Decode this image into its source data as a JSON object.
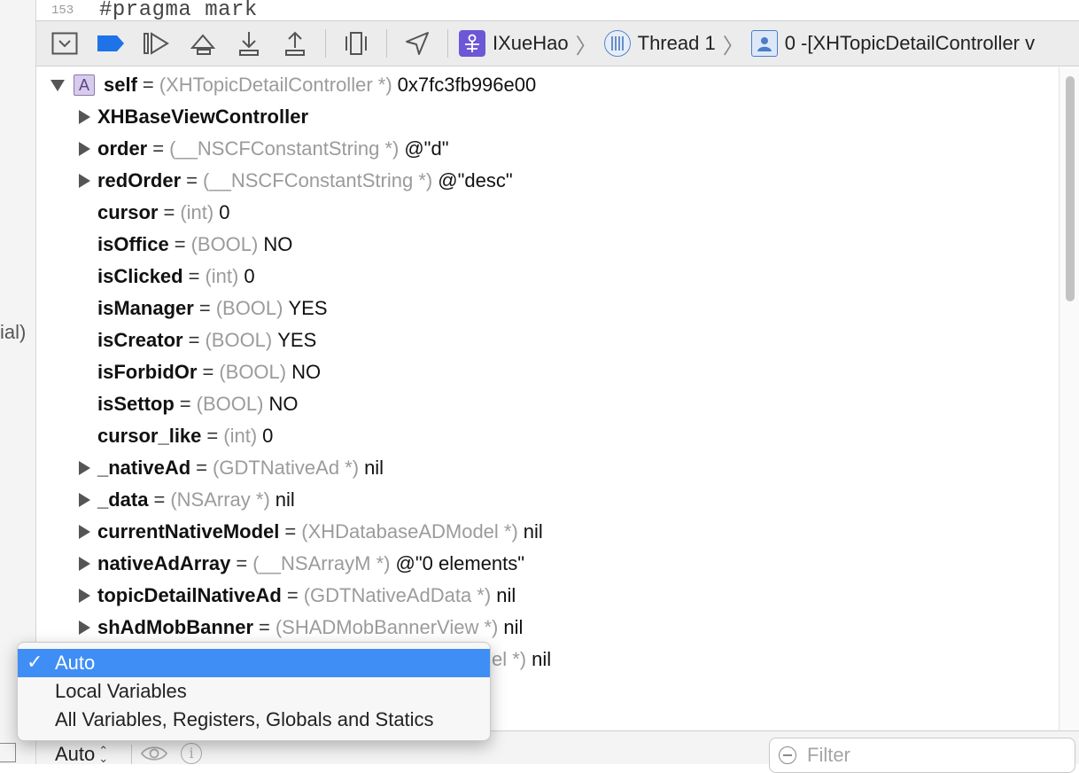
{
  "editor": {
    "line_number": "153",
    "code_line": "#pragma mark"
  },
  "gutter": {
    "partial_text": "ial)"
  },
  "toolbar": {
    "buttons": [
      "hide-debug-area",
      "breakpoints-toggle",
      "continue",
      "step-over",
      "step-into",
      "step-out",
      "view-hierarchy",
      "simulate-location"
    ],
    "breadcrumb": {
      "app": "IXueHao",
      "thread": "Thread 1",
      "frame": "0 -[XHTopicDetailController v"
    }
  },
  "variables": {
    "self": {
      "name": "self",
      "type": "(XHTopicDetailController *)",
      "value": "0x7fc3fb996e00"
    },
    "items": [
      {
        "name": "XHBaseViewController",
        "type": "",
        "value": "",
        "expandable": true
      },
      {
        "name": "order",
        "type": "(__NSCFConstantString *)",
        "value": "@\"d\"",
        "expandable": true
      },
      {
        "name": "redOrder",
        "type": "(__NSCFConstantString *)",
        "value": "@\"desc\"",
        "expandable": true
      },
      {
        "name": "cursor",
        "type": "(int)",
        "value": "0",
        "expandable": false
      },
      {
        "name": "isOffice",
        "type": "(BOOL)",
        "value": "NO",
        "expandable": false
      },
      {
        "name": "isClicked",
        "type": "(int)",
        "value": "0",
        "expandable": false
      },
      {
        "name": "isManager",
        "type": "(BOOL)",
        "value": "YES",
        "expandable": false
      },
      {
        "name": "isCreator",
        "type": "(BOOL)",
        "value": "YES",
        "expandable": false
      },
      {
        "name": "isForbidOr",
        "type": "(BOOL)",
        "value": "NO",
        "expandable": false
      },
      {
        "name": "isSettop",
        "type": "(BOOL)",
        "value": "NO",
        "expandable": false
      },
      {
        "name": "cursor_like",
        "type": "(int)",
        "value": "0",
        "expandable": false
      },
      {
        "name": "_nativeAd",
        "type": "(GDTNativeAd *)",
        "value": "nil",
        "expandable": true
      },
      {
        "name": "_data",
        "type": "(NSArray *)",
        "value": "nil",
        "expandable": true
      },
      {
        "name": "currentNativeModel",
        "type": "(XHDatabaseADModel *)",
        "value": "nil",
        "expandable": true
      },
      {
        "name": "nativeAdArray",
        "type": "(__NSArrayM *)",
        "value": "@\"0 elements\"",
        "expandable": true
      },
      {
        "name": "topicDetailNativeAd",
        "type": "(GDTNativeAdData *)",
        "value": "nil",
        "expandable": true
      },
      {
        "name": "shAdMobBanner",
        "type": "(SHADMobBannerView *)",
        "value": "nil",
        "expandable": true
      }
    ],
    "partial_row": {
      "type_tail": "el *)",
      "value": "nil"
    }
  },
  "scope_menu": {
    "check": "✓",
    "options": [
      "Auto",
      "Local Variables",
      "All Variables, Registers, Globals and Statics"
    ],
    "selected": "Auto"
  },
  "bottom_bar": {
    "scope_label": "Auto",
    "scope_arrows": [
      "⌃",
      "⌄"
    ],
    "info_glyph": "i",
    "filter_placeholder": "Filter",
    "filter_value": ""
  },
  "colors": {
    "menu_highlight": "#3f8ef5",
    "type_gray": "#9b9b9b",
    "badge_purple": "#d8ccec"
  }
}
